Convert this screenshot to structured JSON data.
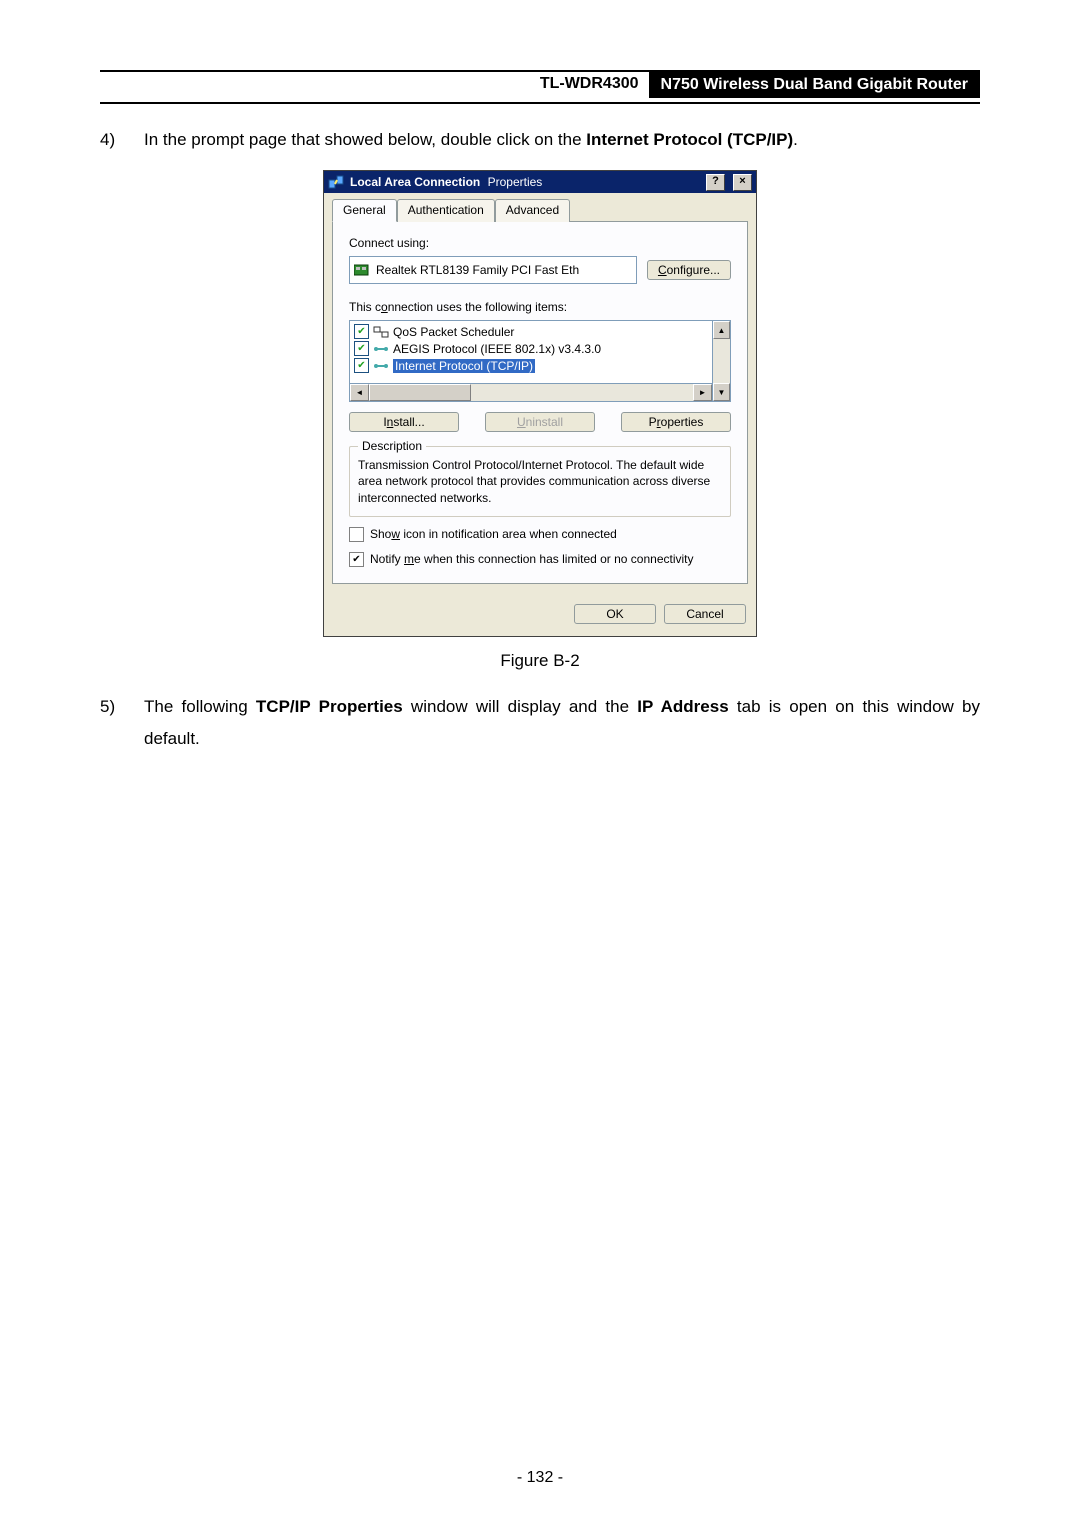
{
  "header": {
    "model": "TL-WDR4300",
    "title": "N750 Wireless Dual Band Gigabit Router"
  },
  "step4": {
    "num": "4)",
    "pre": "In the prompt page that showed below, double click on the ",
    "bold": "Internet Protocol (TCP/IP)",
    "post": "."
  },
  "dialog": {
    "title": "Local Area Connection",
    "title2": "Properties",
    "help": "?",
    "close": "×",
    "tabs": {
      "general": "General",
      "auth": "Authentication",
      "adv": "Advanced"
    },
    "connect_using": "Connect using:",
    "adapter": "Realtek RTL8139 Family PCI Fast Eth",
    "configure": "Configure...",
    "uses_label": "This connection uses the following items:",
    "items": {
      "qos": "QoS Packet Scheduler",
      "aegis": "AEGIS Protocol (IEEE 802.1x) v3.4.3.0",
      "tcpip": "Internet Protocol (TCP/IP)"
    },
    "install": "Install...",
    "uninstall": "Uninstall",
    "properties": "Properties",
    "desc_title": "Description",
    "desc_text": "Transmission Control Protocol/Internet Protocol. The default wide area network protocol that provides communication across diverse interconnected networks.",
    "show_icon": "Show icon in notification area when connected",
    "notify": "Notify me when this connection has limited or no connectivity",
    "ok": "OK",
    "cancel": "Cancel"
  },
  "figure_caption": "Figure B-2",
  "step5": {
    "num": "5)",
    "pre": "The following ",
    "bold1": "TCP/IP Properties",
    "mid": " window will display and the ",
    "bold2": "IP Address",
    "post": " tab is open on this window by default."
  },
  "page_number": "- 132 -"
}
